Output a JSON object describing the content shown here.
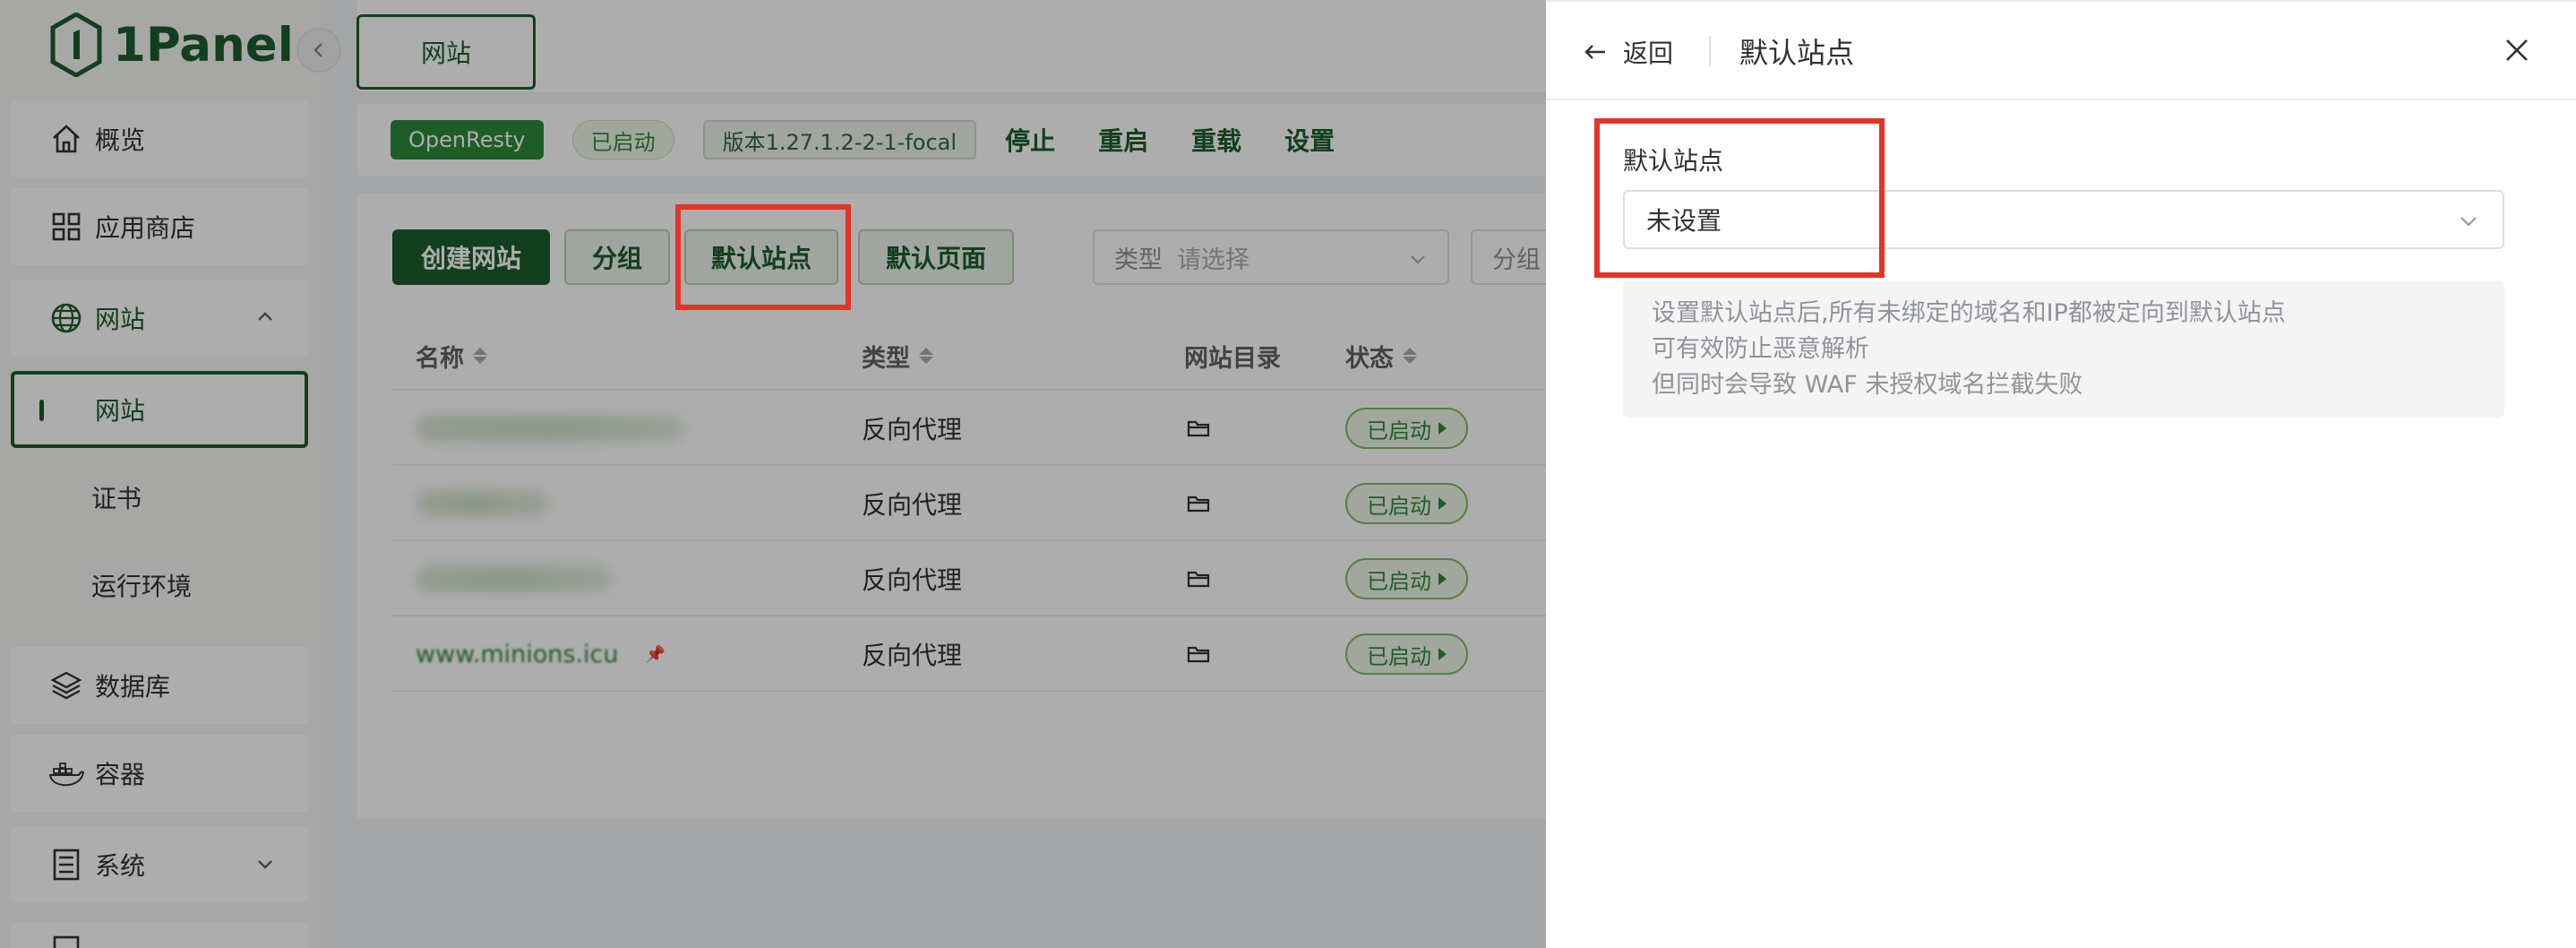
{
  "app": {
    "logo_text": "1Panel"
  },
  "sidebar": {
    "items": [
      {
        "label": "概览",
        "icon": "home-icon"
      },
      {
        "label": "应用商店",
        "icon": "grid-icon"
      },
      {
        "label": "网站",
        "icon": "globe-icon"
      },
      {
        "label": "网站"
      },
      {
        "label": "证书"
      },
      {
        "label": "运行环境"
      },
      {
        "label": "数据库",
        "icon": "layers-icon"
      },
      {
        "label": "容器",
        "icon": "docker-icon"
      },
      {
        "label": "系统",
        "icon": "server-icon"
      }
    ]
  },
  "header": {
    "tab_label": "网站"
  },
  "status": {
    "server": "OpenResty",
    "state": "已启动",
    "version": "版本1.27.1.2-2-1-focal",
    "actions": [
      "停止",
      "重启",
      "重载",
      "设置"
    ]
  },
  "toolbar": {
    "create_label": "创建网站",
    "group_label": "分组",
    "default_site_label": "默认站点",
    "default_page_label": "默认页面",
    "type_filter_label": "类型",
    "type_filter_placeholder": "请选择",
    "group_filter_label": "分组"
  },
  "table": {
    "columns": [
      "名称",
      "类型",
      "网站目录",
      "状态"
    ],
    "rows": [
      {
        "name": "",
        "type": "反向代理",
        "state": "已启动"
      },
      {
        "name": "",
        "type": "反向代理",
        "state": "已启动"
      },
      {
        "name": "",
        "type": "反向代理",
        "state": "已启动"
      },
      {
        "name": "www.minions.icu",
        "type": "反向代理",
        "state": "已启动"
      }
    ]
  },
  "drawer": {
    "back_label": "返回",
    "title": "默认站点",
    "field_label": "默认站点",
    "field_value": "未设置",
    "info_lines": [
      "设置默认站点后,所有未绑定的域名和IP都被定向到默认站点",
      "可有效防止恶意解析",
      "但同时会导致 WAF 未授权域名拦截失败"
    ]
  },
  "colors": {
    "brand": "#1b5e2c",
    "accent_green": "#2f8a3b",
    "highlight_red": "#e53328"
  }
}
